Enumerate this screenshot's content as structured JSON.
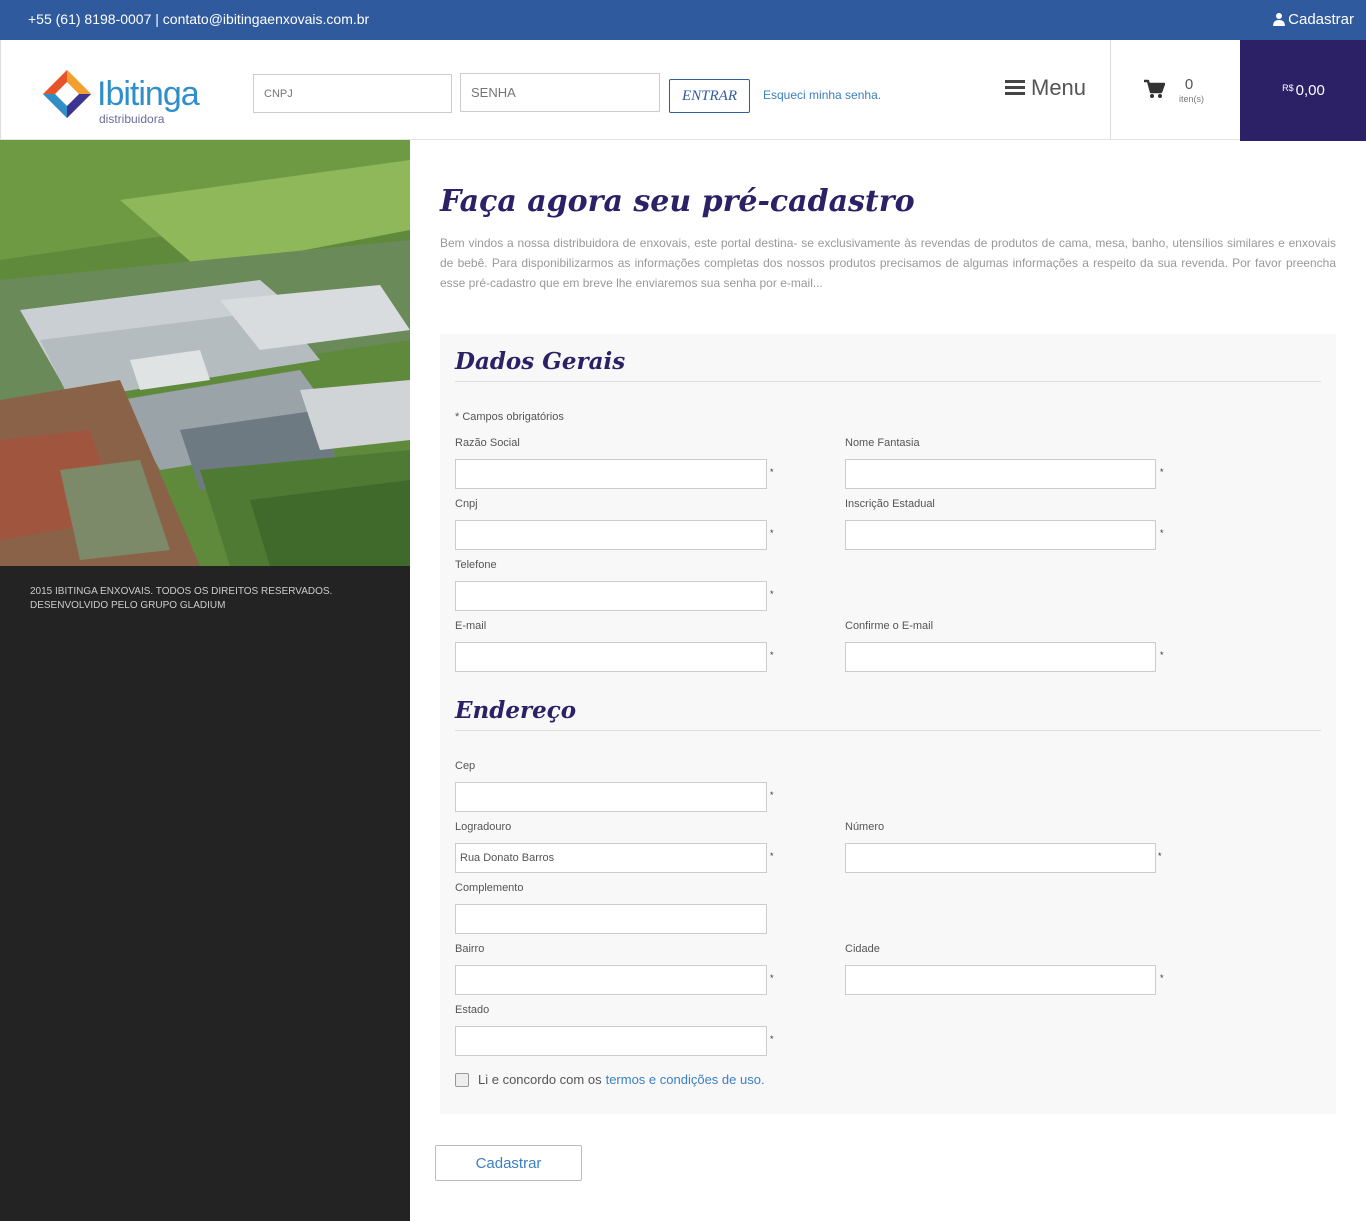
{
  "topbar": {
    "contact": "+55 (61) 8198-0007 | contato@ibitingaenxovais.com.br",
    "signup_label": "Cadastrar"
  },
  "header": {
    "logo_brand": "Ibitinga",
    "logo_sub": "distribuidora",
    "cnpj_placeholder": "CNPJ",
    "senha_placeholder": "SENHA",
    "login_label": "ENTRAR",
    "forgot_label": "Esqueci minha senha.",
    "menu_label": "Menu",
    "cart_count": "0",
    "cart_label": "iten(s)",
    "currency": "R$",
    "cart_total": "0,00"
  },
  "sidebar": {
    "footer_line1": "2015 Ibitinga Enxovais. Todos os direitos reservados.",
    "footer_line2": "Desenvolvido pelo Grupo Gladium"
  },
  "main": {
    "title": "Faça agora seu pré-cadastro",
    "intro": "Bem vindos a nossa distribuidora de enxovais, este portal destina- se exclusivamente às revendas de produtos de cama, mesa, banho, utensílios similares e enxovais de bebê. Para disponibilizarmos as informações completas dos nossos produtos precisamos de algumas informações a respeito da sua revenda. Por favor preencha esse pré-cadastro que em breve lhe enviaremos sua senha por e-mail..."
  },
  "form": {
    "general_title": "Dados Gerais",
    "required_note": "* Campos obrigatórios",
    "address_title": "Endereço",
    "required_mark": "*",
    "fields": {
      "razao_social": {
        "label": "Razão Social",
        "value": ""
      },
      "nome_fantasia": {
        "label": "Nome Fantasia",
        "value": ""
      },
      "cnpj": {
        "label": "Cnpj",
        "value": ""
      },
      "inscricao": {
        "label": "Inscrição Estadual",
        "value": ""
      },
      "telefone": {
        "label": "Telefone",
        "value": ""
      },
      "email": {
        "label": "E-mail",
        "value": ""
      },
      "email_confirm": {
        "label": "Confirme o E-mail",
        "value": ""
      },
      "cep": {
        "label": "Cep",
        "value": ""
      },
      "logradouro": {
        "label": "Logradouro",
        "value": "Rua Donato Barros"
      },
      "numero": {
        "label": "Número",
        "value": ""
      },
      "complemento": {
        "label": "Complemento",
        "value": ""
      },
      "bairro": {
        "label": "Bairro",
        "value": ""
      },
      "cidade": {
        "label": "Cidade",
        "value": ""
      },
      "estado": {
        "label": "Estado",
        "value": ""
      }
    },
    "agree_text": "Li e concordo com os",
    "agree_link": "termos e condições de uso.",
    "submit_label": "Cadastrar"
  }
}
